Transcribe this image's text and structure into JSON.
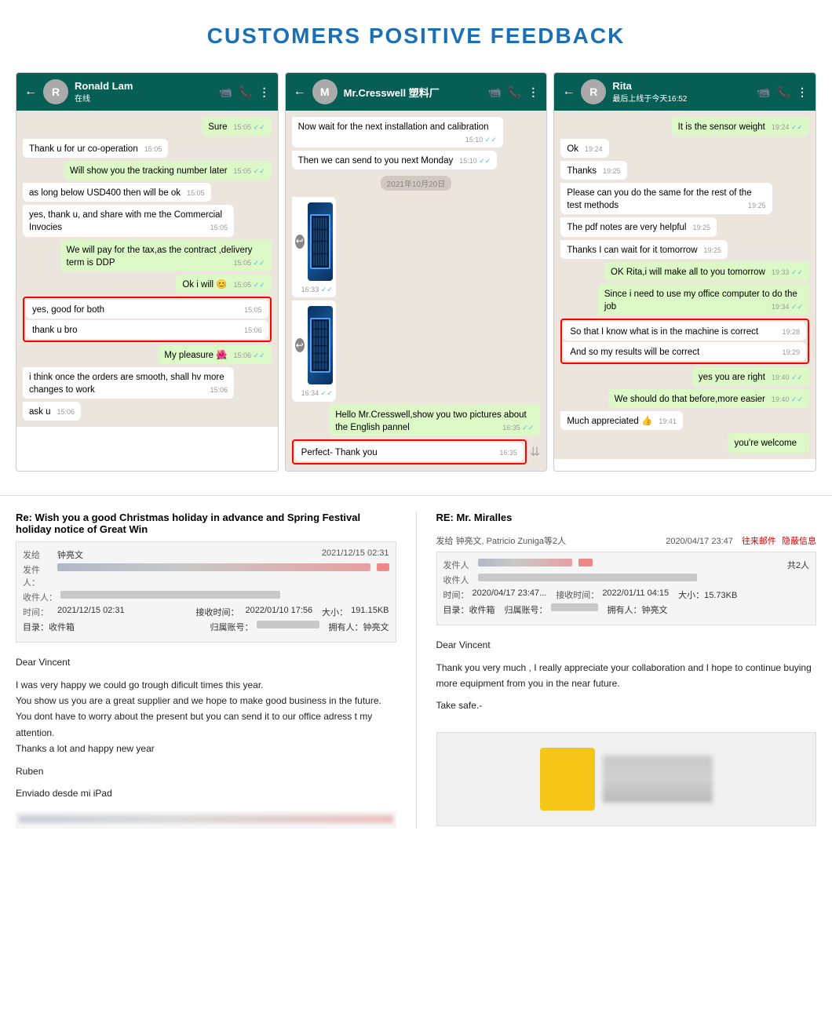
{
  "page": {
    "title": "CUSTOMERS POSITIVE FEEDBACK"
  },
  "chat1": {
    "name": "Ronald Lam",
    "status": "在线",
    "messages": [
      {
        "id": "c1m1",
        "text": "Sure",
        "time": "15:05",
        "side": "right",
        "tick": "✓✓"
      },
      {
        "id": "c1m2",
        "text": "Thank u for ur co-operation",
        "time": "15:05",
        "side": "left"
      },
      {
        "id": "c1m3",
        "text": "Will show you the tracking number later",
        "time": "15:05",
        "side": "right",
        "tick": "✓✓"
      },
      {
        "id": "c1m4",
        "text": "as long below USD400 then will be ok",
        "time": "15:05",
        "side": "left"
      },
      {
        "id": "c1m5",
        "text": "yes, thank u, and share with me the Commercial Invocies",
        "time": "15:05",
        "side": "left"
      },
      {
        "id": "c1m6",
        "text": "We will pay for the tax,as the contract ,delivery term is DDP",
        "time": "15:05",
        "side": "right",
        "tick": "✓✓"
      },
      {
        "id": "c1m7",
        "text": "Ok i will 😊",
        "time": "15:05",
        "side": "right",
        "tick": "✓✓"
      },
      {
        "id": "c1m8",
        "text": "yes, good for both",
        "time": "15:05",
        "side": "left",
        "highlight": true
      },
      {
        "id": "c1m9",
        "text": "thank u bro",
        "time": "15:06",
        "side": "left",
        "highlight": true
      },
      {
        "id": "c1m10",
        "text": "My pleasure 🌺",
        "time": "15:06",
        "side": "right",
        "tick": "✓✓"
      },
      {
        "id": "c1m11",
        "text": "i think once the orders are smooth, shall hv more changes to work",
        "time": "15:06",
        "side": "left"
      },
      {
        "id": "c1m12",
        "text": "ask u",
        "time": "15:06",
        "side": "left"
      }
    ]
  },
  "chat2": {
    "name": "Mr.Cresswell 塑料厂",
    "messages": [
      {
        "id": "c2m1",
        "text": "Now wait for the next installation and calibration",
        "time": "15:10",
        "side": "left",
        "tick": "✓✓"
      },
      {
        "id": "c2m2",
        "text": "Then we can send to you next Monday",
        "time": "15:10",
        "side": "left",
        "tick": "✓✓"
      },
      {
        "id": "c2date",
        "type": "date",
        "text": "2021年10月20日"
      },
      {
        "id": "c2m3",
        "type": "image",
        "time": "16:33",
        "tick": "✓✓",
        "side": "left"
      },
      {
        "id": "c2m4",
        "type": "image",
        "time": "16:34",
        "tick": "✓✓",
        "side": "left"
      },
      {
        "id": "c2m5",
        "text": "Hello Mr.Cresswell,show you two pictures about the English pannel",
        "time": "16:35",
        "side": "right",
        "tick": "✓✓"
      },
      {
        "id": "c2m6",
        "text": "Perfect- Thank you",
        "time": "16:35",
        "side": "left",
        "highlight": true
      }
    ]
  },
  "chat3": {
    "name": "Rita",
    "status": "最后上线于今天16:52",
    "messages": [
      {
        "id": "c3m1",
        "text": "It is the sensor weight",
        "time": "19:24",
        "side": "right",
        "tick": "✓✓"
      },
      {
        "id": "c3m2",
        "text": "Ok",
        "time": "19:24",
        "side": "left"
      },
      {
        "id": "c3m3",
        "text": "Thanks",
        "time": "19:25",
        "side": "left"
      },
      {
        "id": "c3m4",
        "text": "Please can you do the same for the rest of the test methods",
        "time": "19:25",
        "side": "left"
      },
      {
        "id": "c3m5",
        "text": "The pdf notes are very helpful",
        "time": "19:25",
        "side": "left"
      },
      {
        "id": "c3m6",
        "text": "Thanks I can wait for it tomorrow",
        "time": "19:25",
        "side": "left"
      },
      {
        "id": "c3m7",
        "text": "OK Rita,i will make all to you tomorrow",
        "time": "19:33",
        "side": "right",
        "tick": "✓✓"
      },
      {
        "id": "c3m8",
        "text": "Since i need to use my office computer to do the job",
        "time": "19:34",
        "side": "right",
        "tick": "✓✓"
      },
      {
        "id": "c3m9",
        "text": "So that I know what is in the machine is correct",
        "time": "19:28",
        "side": "left",
        "highlight": true
      },
      {
        "id": "c3m10",
        "text": "And so my results will be correct",
        "time": "19:29",
        "side": "left",
        "highlight": true
      },
      {
        "id": "c3m11",
        "text": "yes you are right",
        "time": "19:40",
        "side": "right",
        "tick": "✓✓"
      },
      {
        "id": "c3m12",
        "text": "We should do that before,more easier",
        "time": "19:40",
        "side": "right",
        "tick": "✓✓"
      },
      {
        "id": "c3m13",
        "text": "Much appreciated 👍",
        "time": "19:41",
        "side": "left"
      },
      {
        "id": "c3m14",
        "text": "you're welcome",
        "time": "",
        "side": "right"
      }
    ]
  },
  "email1": {
    "subject": "Re: Wish you a good Christmas holiday in advance and Spring Festival holiday notice of Great Win",
    "from_label": "发给",
    "from_value": "钟亮文",
    "sender_label": "发件人：",
    "recipient_label": "收件人：",
    "time_label": "时间：",
    "time_value": "2021/12/15 02:31",
    "received_label": "接收时间：",
    "received_value": "2022/01/10 17:56",
    "size_label": "大小：",
    "size_value": "191.15KB",
    "folder_label": "目录：收件箱",
    "account_label": "归属账号：",
    "holder_label": "拥有人：钟亮文",
    "date_sent": "2021/12/15 02:31",
    "body_greeting": "Dear Vincent",
    "body_text": "I was very happy we could go trough dificult times this year.\nYou show us you are a great supplier and we hope to make good business in the future.  You dont have to worry about the present but you can send it to our office adress t my attention.\nThanks a lot and happy new year",
    "body_signature": "Ruben",
    "body_footer": "Enviado desde mi iPad",
    "blurred_footer": "blurred text here"
  },
  "email2": {
    "subject": "RE: Mr. Miralles",
    "from_label": "发给",
    "from_names": "钟亮文, Patricio Zuniga等2人",
    "date_label": "2020/04/17 23:47",
    "action_label": "往来邮件",
    "hide_label": "隐蔽信息",
    "sender_label": "发件人",
    "recipient_label": "收件人",
    "count_label": "共2人",
    "time_sent": "2020/04/17 23:47...",
    "received_time": "2022/01/11 04:15",
    "size": "大小：15.73KB",
    "folder": "目录：收件箱",
    "account": "归属账号：",
    "holder": "拥有人：钟亮文",
    "greeting": "Dear Vincent",
    "body": "Thank you very much , I really appreciate your collaboration and I hope to continue buying more equipment from you in the near future.",
    "closing": "Take safe.-"
  },
  "icons": {
    "back": "←",
    "video": "📹",
    "phone": "📞",
    "menu": "⋮",
    "forward": "⏩"
  }
}
